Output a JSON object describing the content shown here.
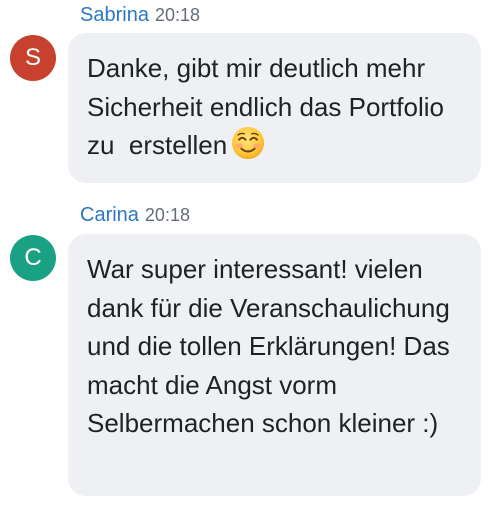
{
  "messages": [
    {
      "sender": "Sabrina",
      "time": "20:18",
      "avatar_initial": "S",
      "avatar_color": "#c8412f",
      "text": "Danke, gibt mir deutlich mehr Sicherheit endlich das Portfolio zu  erstellen",
      "trailing_emoji": "smiling-face-with-smiling-eyes-icon"
    },
    {
      "sender": "Carina",
      "time": "20:18",
      "avatar_initial": "C",
      "avatar_color": "#1aa184",
      "text": "War super interessant! vielen dank für die Veranschaulichung und die tollen Erklärungen! Das macht die Angst vorm Selbermachen schon kleiner :)"
    }
  ],
  "colors": {
    "sender_name": "#2b78c5",
    "timestamp": "#666d75",
    "bubble_background": "#eef0f3",
    "message_text": "#1f2124"
  }
}
